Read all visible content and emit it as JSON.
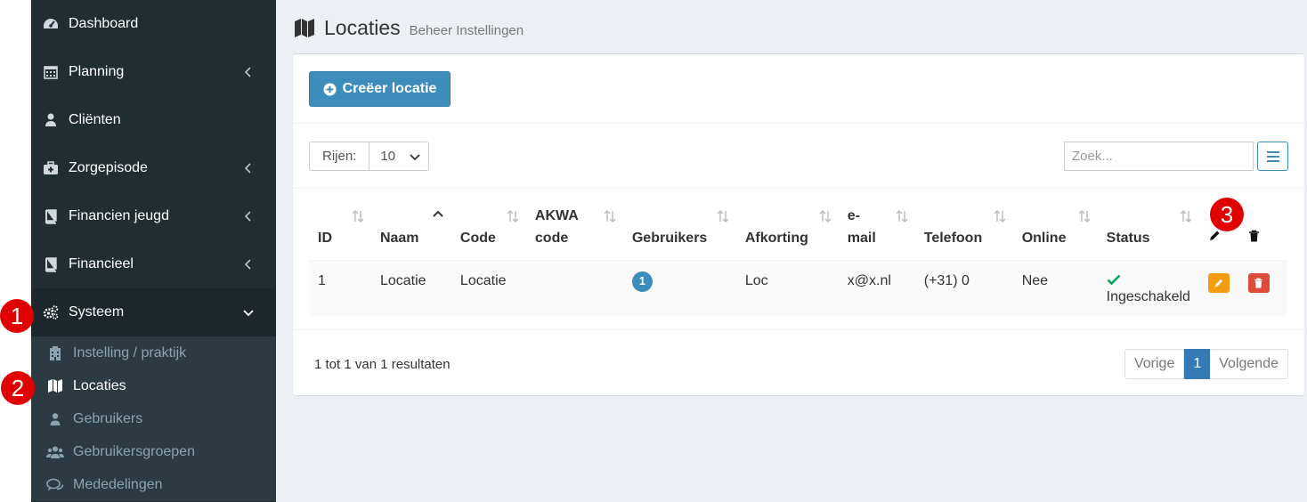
{
  "sidebar": {
    "items": [
      {
        "label": "Dashboard",
        "icon": "dashboard-icon"
      },
      {
        "label": "Planning",
        "icon": "calendar-icon"
      },
      {
        "label": "Cliënten",
        "icon": "user-icon"
      },
      {
        "label": "Zorgepisode",
        "icon": "medkit-icon"
      },
      {
        "label": "Financien jeugd",
        "icon": "book-icon"
      },
      {
        "label": "Financieel",
        "icon": "book-icon"
      },
      {
        "label": "Systeem",
        "icon": "cogs-icon"
      }
    ],
    "submenu": [
      {
        "label": "Instelling / praktijk",
        "icon": "hospital-icon"
      },
      {
        "label": "Locaties",
        "icon": "map-icon"
      },
      {
        "label": "Gebruikers",
        "icon": "user-icon"
      },
      {
        "label": "Gebruikersgroepen",
        "icon": "users-icon"
      },
      {
        "label": "Mededelingen",
        "icon": "comments-icon"
      }
    ]
  },
  "header": {
    "title": "Locaties",
    "subtitle": "Beheer Instellingen"
  },
  "toolbar": {
    "create_label": "Creëer locatie",
    "rows_label": "Rijen:",
    "rows_value": "10",
    "search_placeholder": "Zoek..."
  },
  "table": {
    "columns": [
      "ID",
      "Naam",
      "Code",
      "AKWA code",
      "Gebruikers",
      "Afkorting",
      "e-mail",
      "Telefoon",
      "Online",
      "Status"
    ],
    "rows": [
      {
        "id": "1",
        "naam": "Locatie",
        "code": "Locatie",
        "akwa": "",
        "gebruikers": "1",
        "afkorting": "Loc",
        "email": "x@x.nl",
        "telefoon": "(+31) 0",
        "online": "Nee",
        "status": "Ingeschakeld"
      }
    ]
  },
  "footer": {
    "summary": "1 tot 1 van 1 resultaten",
    "prev": "Vorige",
    "page": "1",
    "next": "Volgende"
  },
  "markers": [
    "1",
    "2",
    "3"
  ],
  "colors": {
    "sidebar": "#222d32",
    "primary": "#3c8dbc",
    "edit": "#f39c12",
    "delete": "#dd4b39",
    "success": "#00a65a",
    "marker": "#e00000"
  }
}
